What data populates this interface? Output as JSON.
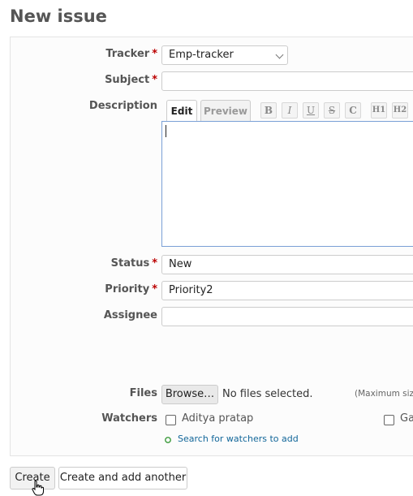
{
  "page": {
    "title": "New issue"
  },
  "form": {
    "required_mark": "*",
    "tracker": {
      "label": "Tracker",
      "value": "Emp-tracker"
    },
    "subject": {
      "label": "Subject",
      "value": ""
    },
    "description": {
      "label": "Description",
      "tabs": {
        "edit": "Edit",
        "preview": "Preview"
      },
      "toolbar": {
        "bold": "B",
        "italic": "I",
        "underline": "U",
        "strike": "S",
        "code": "C",
        "h1": "H1",
        "h2": "H2"
      },
      "value": ""
    },
    "status": {
      "label": "Status",
      "value": "New"
    },
    "priority": {
      "label": "Priority",
      "value": "Priority2"
    },
    "assignee": {
      "label": "Assignee",
      "value": ""
    },
    "files": {
      "label": "Files",
      "browse_label": "Browse…",
      "status": "No files selected.",
      "max_size_note": "(Maximum size"
    },
    "watchers": {
      "label": "Watchers",
      "users": [
        {
          "name": "Aditya pratap",
          "checked": false
        },
        {
          "name": "Ga",
          "checked": false
        }
      ],
      "search_link": "Search for watchers to add"
    }
  },
  "actions": {
    "create": "Create",
    "create_and_add_another": "Create and add another"
  },
  "colors": {
    "required": "#bb0000",
    "link": "#169",
    "editor_border": "#7aa0d6",
    "add_icon": "#3a9a3a"
  }
}
